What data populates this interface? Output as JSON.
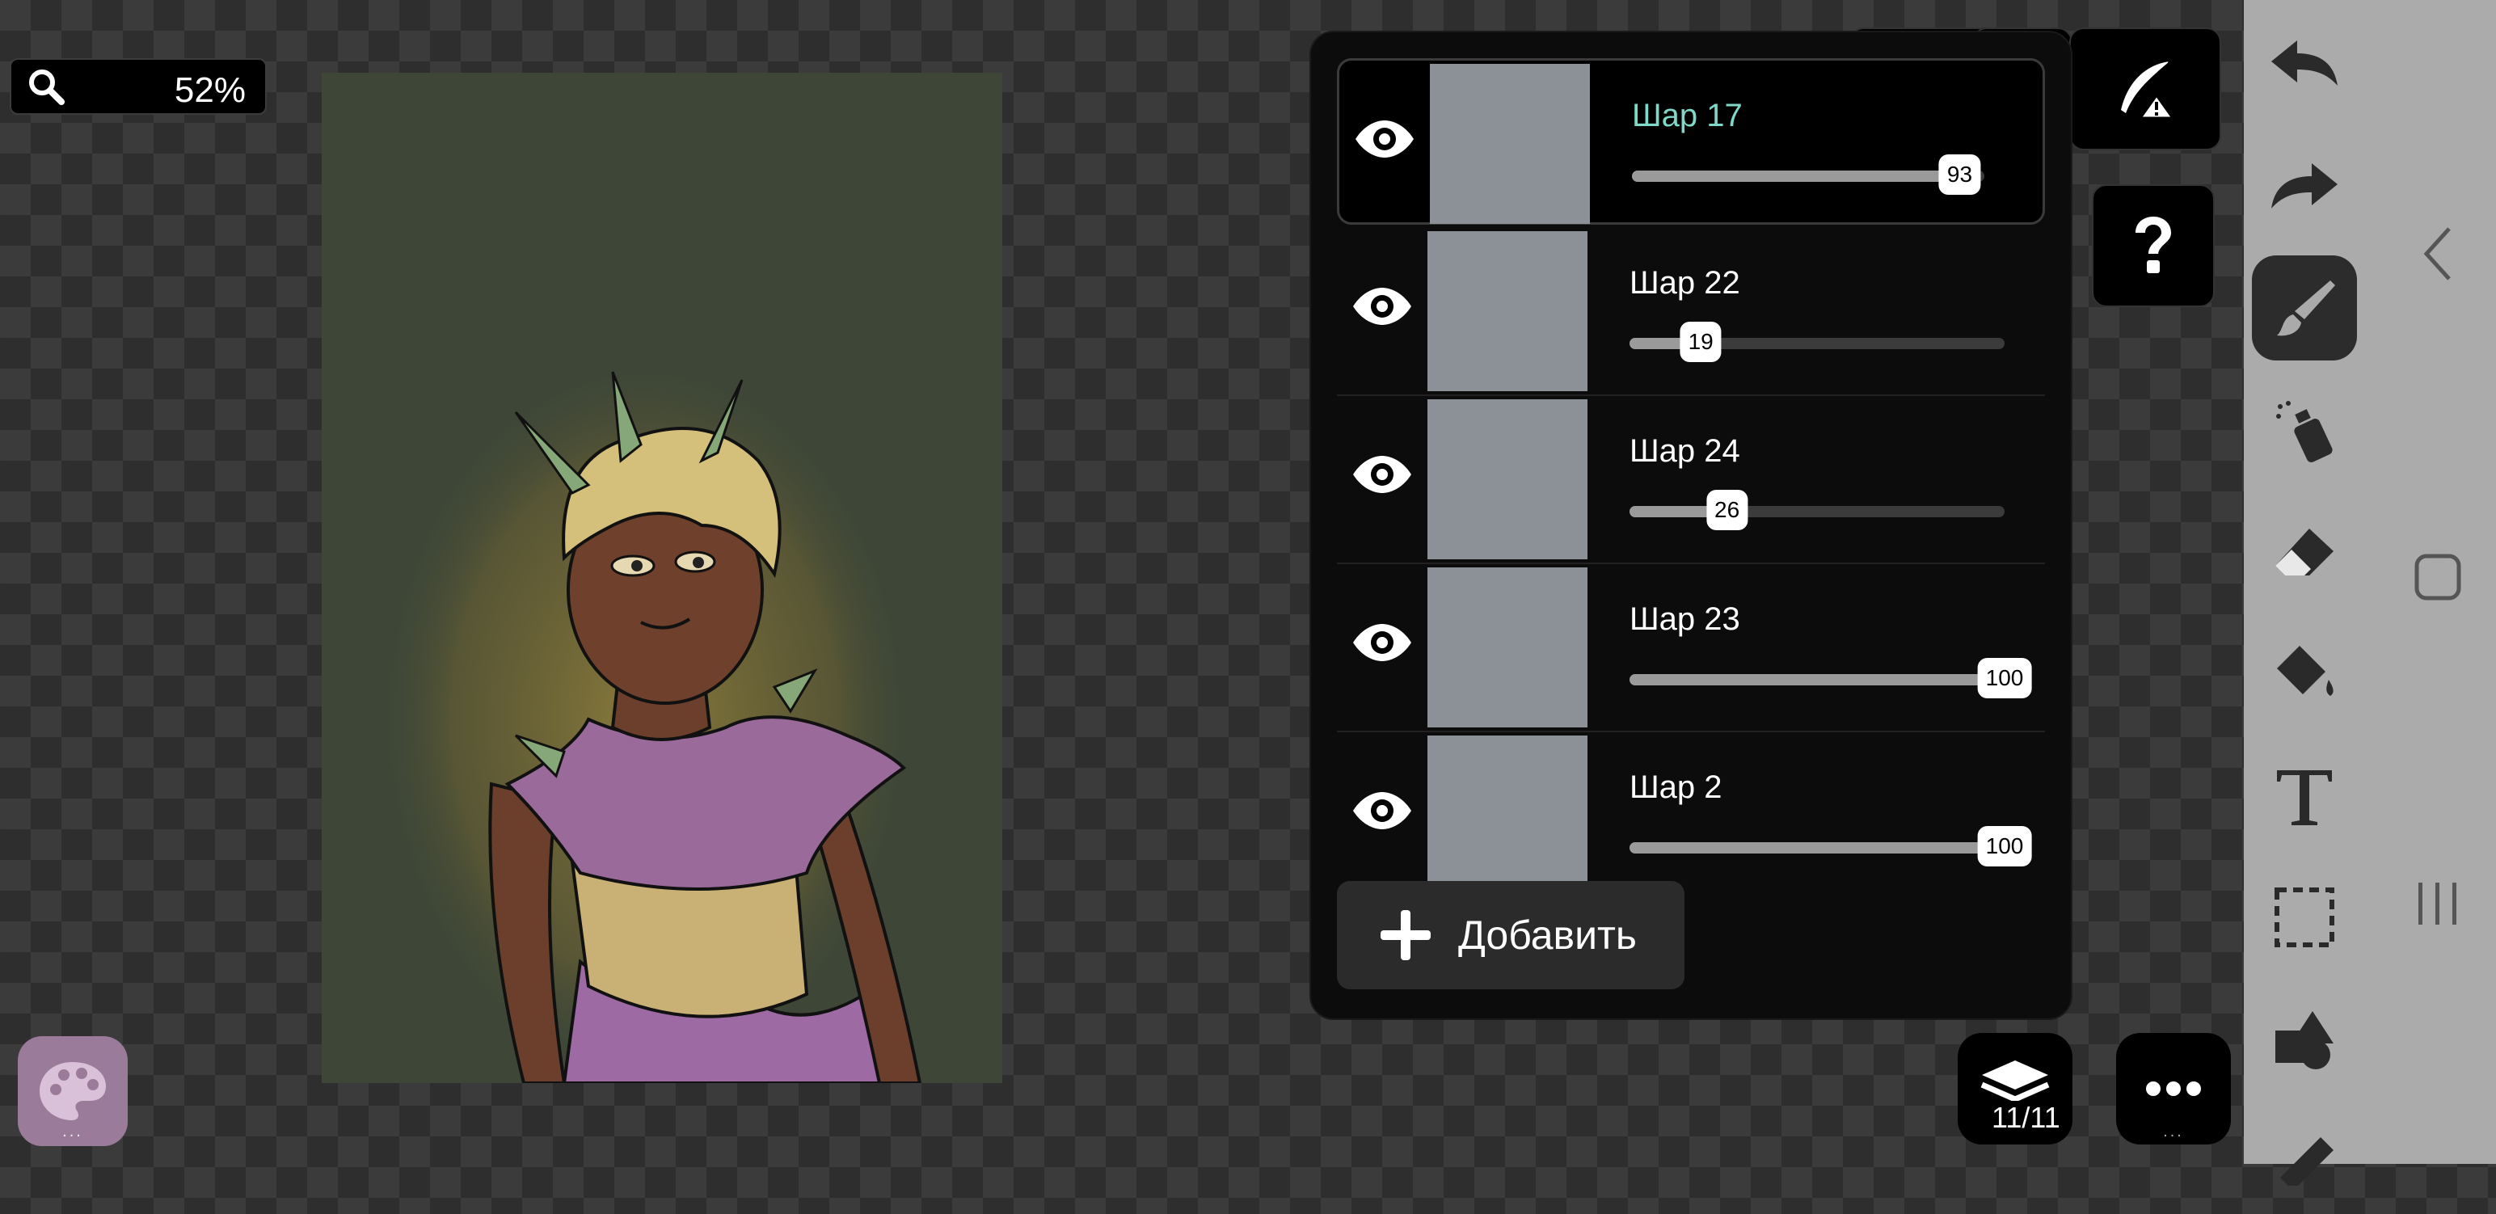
{
  "zoom": {
    "value": "52%"
  },
  "layers": {
    "items": [
      {
        "name": "Шар 17",
        "opacity": 93,
        "opacity_label": "93",
        "selected": true
      },
      {
        "name": "Шар 22",
        "opacity": 19,
        "opacity_label": "19",
        "selected": false
      },
      {
        "name": "Шар 24",
        "opacity": 26,
        "opacity_label": "26",
        "selected": false
      },
      {
        "name": "Шар 23",
        "opacity": 100,
        "opacity_label": "100",
        "selected": false
      },
      {
        "name": "Шар 2",
        "opacity": 100,
        "opacity_label": "100",
        "selected": false
      }
    ],
    "add_label": "Добавить",
    "count_label": "11/11"
  },
  "palette": {
    "dots": "..."
  },
  "more": {
    "dots": "..."
  },
  "colors": {
    "selected_layer_name": "#7fd8c8",
    "panel_bg": "#0c0c0c",
    "toolbar_bg": "#ababab",
    "canvas_bg": "#3d4637",
    "palette_bg": "#9a7b9a"
  },
  "toolbar": {
    "tools": [
      "undo-icon",
      "redo-icon",
      "brush-icon",
      "spray-can-icon",
      "eraser-icon",
      "fill-bucket-icon",
      "text-tool-icon",
      "selection-icon",
      "shapes-icon",
      "ruler-icon"
    ],
    "active_tool": "brush-icon"
  }
}
